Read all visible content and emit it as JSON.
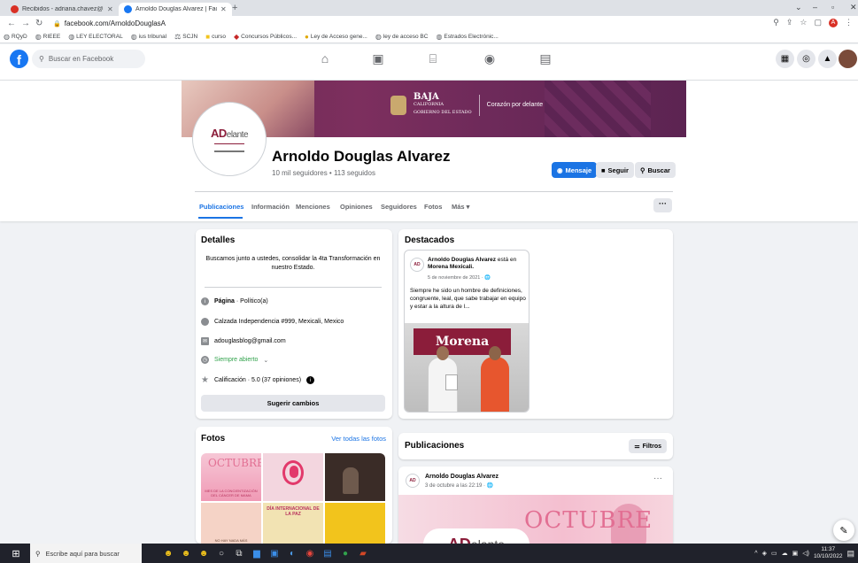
{
  "browser": {
    "tabs": [
      {
        "title": "Recibidos - adriana.chavez@iee.",
        "favicon_color": "#d93025",
        "active": false
      },
      {
        "title": "Arnoldo Douglas Alvarez | Faceb",
        "favicon_color": "#1877f2",
        "active": true
      }
    ],
    "new_tab": "+",
    "url": "facebook.com/ArnoldoDouglasA",
    "profile_initial": "A",
    "bookmarks": [
      "RQyD",
      "RIEEE",
      "LEY ELECTORAL",
      "ius tribunal",
      "SCJN",
      "curso",
      "Concursos Públicos...",
      "Ley de Acceso gene...",
      "ley de acceso BC",
      "Estrados Electrónic..."
    ]
  },
  "facebook": {
    "logo": "f",
    "search_placeholder": "Buscar en Facebook",
    "nav_icons": [
      "home-icon",
      "watch-icon",
      "marketplace-icon",
      "groups-icon",
      "gaming-icon"
    ],
    "right_icons": [
      "menu-grid-icon",
      "messenger-icon",
      "notifications-icon",
      "account-icon"
    ]
  },
  "cover": {
    "state_name": "BAJA",
    "state_sub": "CALIFORNIA",
    "state_caption": "GOBIERNO DEL ESTADO",
    "slogan": "Corazón por delante"
  },
  "profile": {
    "logo_text": "AD",
    "logo_suffix": "elante",
    "name": "Arnoldo Douglas Alvarez",
    "stats": "10 mil seguidores • 113 seguidos",
    "buttons": {
      "message": "Mensaje",
      "follow": "Seguir",
      "search": "Buscar"
    },
    "tabs": [
      "Publicaciones",
      "Información",
      "Menciones",
      "Opiniones",
      "Seguidores",
      "Fotos",
      "Más ▾"
    ],
    "more_button": "···"
  },
  "details": {
    "title": "Detalles",
    "bio": "Buscamos junto a ustedes, consolidar la 4ta Transformación en nuestro Estado.",
    "page_label": "Página",
    "page_category": " · Político(a)",
    "address": "Calzada Independencia #999, Mexicali, Mexico",
    "email": "adouglasblog@gmail.com",
    "hours": "Siempre abierto",
    "hours_chevron": "⌄",
    "rating": "Calificación · 5.0 (37 opiniones)",
    "suggest_button": "Sugerir cambios"
  },
  "photos": {
    "title": "Fotos",
    "see_all": "Ver todas las fotos",
    "items": [
      {
        "headline": "OCTUBRE",
        "caption": "MES DE LA CONCIENTIZACIÓN DEL CÁNCER DE MAMA"
      },
      {
        "headline": "",
        "caption": ""
      },
      {
        "headline": "",
        "caption": ""
      },
      {
        "headline": "",
        "caption": "NO HAY NADA MÁS"
      },
      {
        "headline": "DÍA INTERNACIONAL DE LA PAZ",
        "caption": ""
      },
      {
        "headline": "",
        "caption": ""
      }
    ]
  },
  "featured": {
    "title": "Destacados",
    "author": "Arnoldo Douglas Alvarez",
    "action": " está en ",
    "place": "Morena Mexicali.",
    "date": "5 de noviembre de 2021 · 🌐",
    "text": "Siempre he sido un hombre de definiciones, congruente, leal, que sabe trabajar en equipo y estar a la altura de l...",
    "banner": "Morena"
  },
  "posts": {
    "title": "Publicaciones",
    "filter_button": "Filtros",
    "items": [
      {
        "author": "Arnoldo Douglas Alvarez",
        "date": "3 de octubre a las 22:19 · 🌐",
        "more": "···",
        "image_headline": "OCTUBRE",
        "image_logo": "AD",
        "image_logo_suffix": "elante"
      }
    ]
  },
  "taskbar": {
    "search_placeholder": "Escribe aquí para buscar",
    "time": "11:37",
    "date": "10/10/2022"
  }
}
